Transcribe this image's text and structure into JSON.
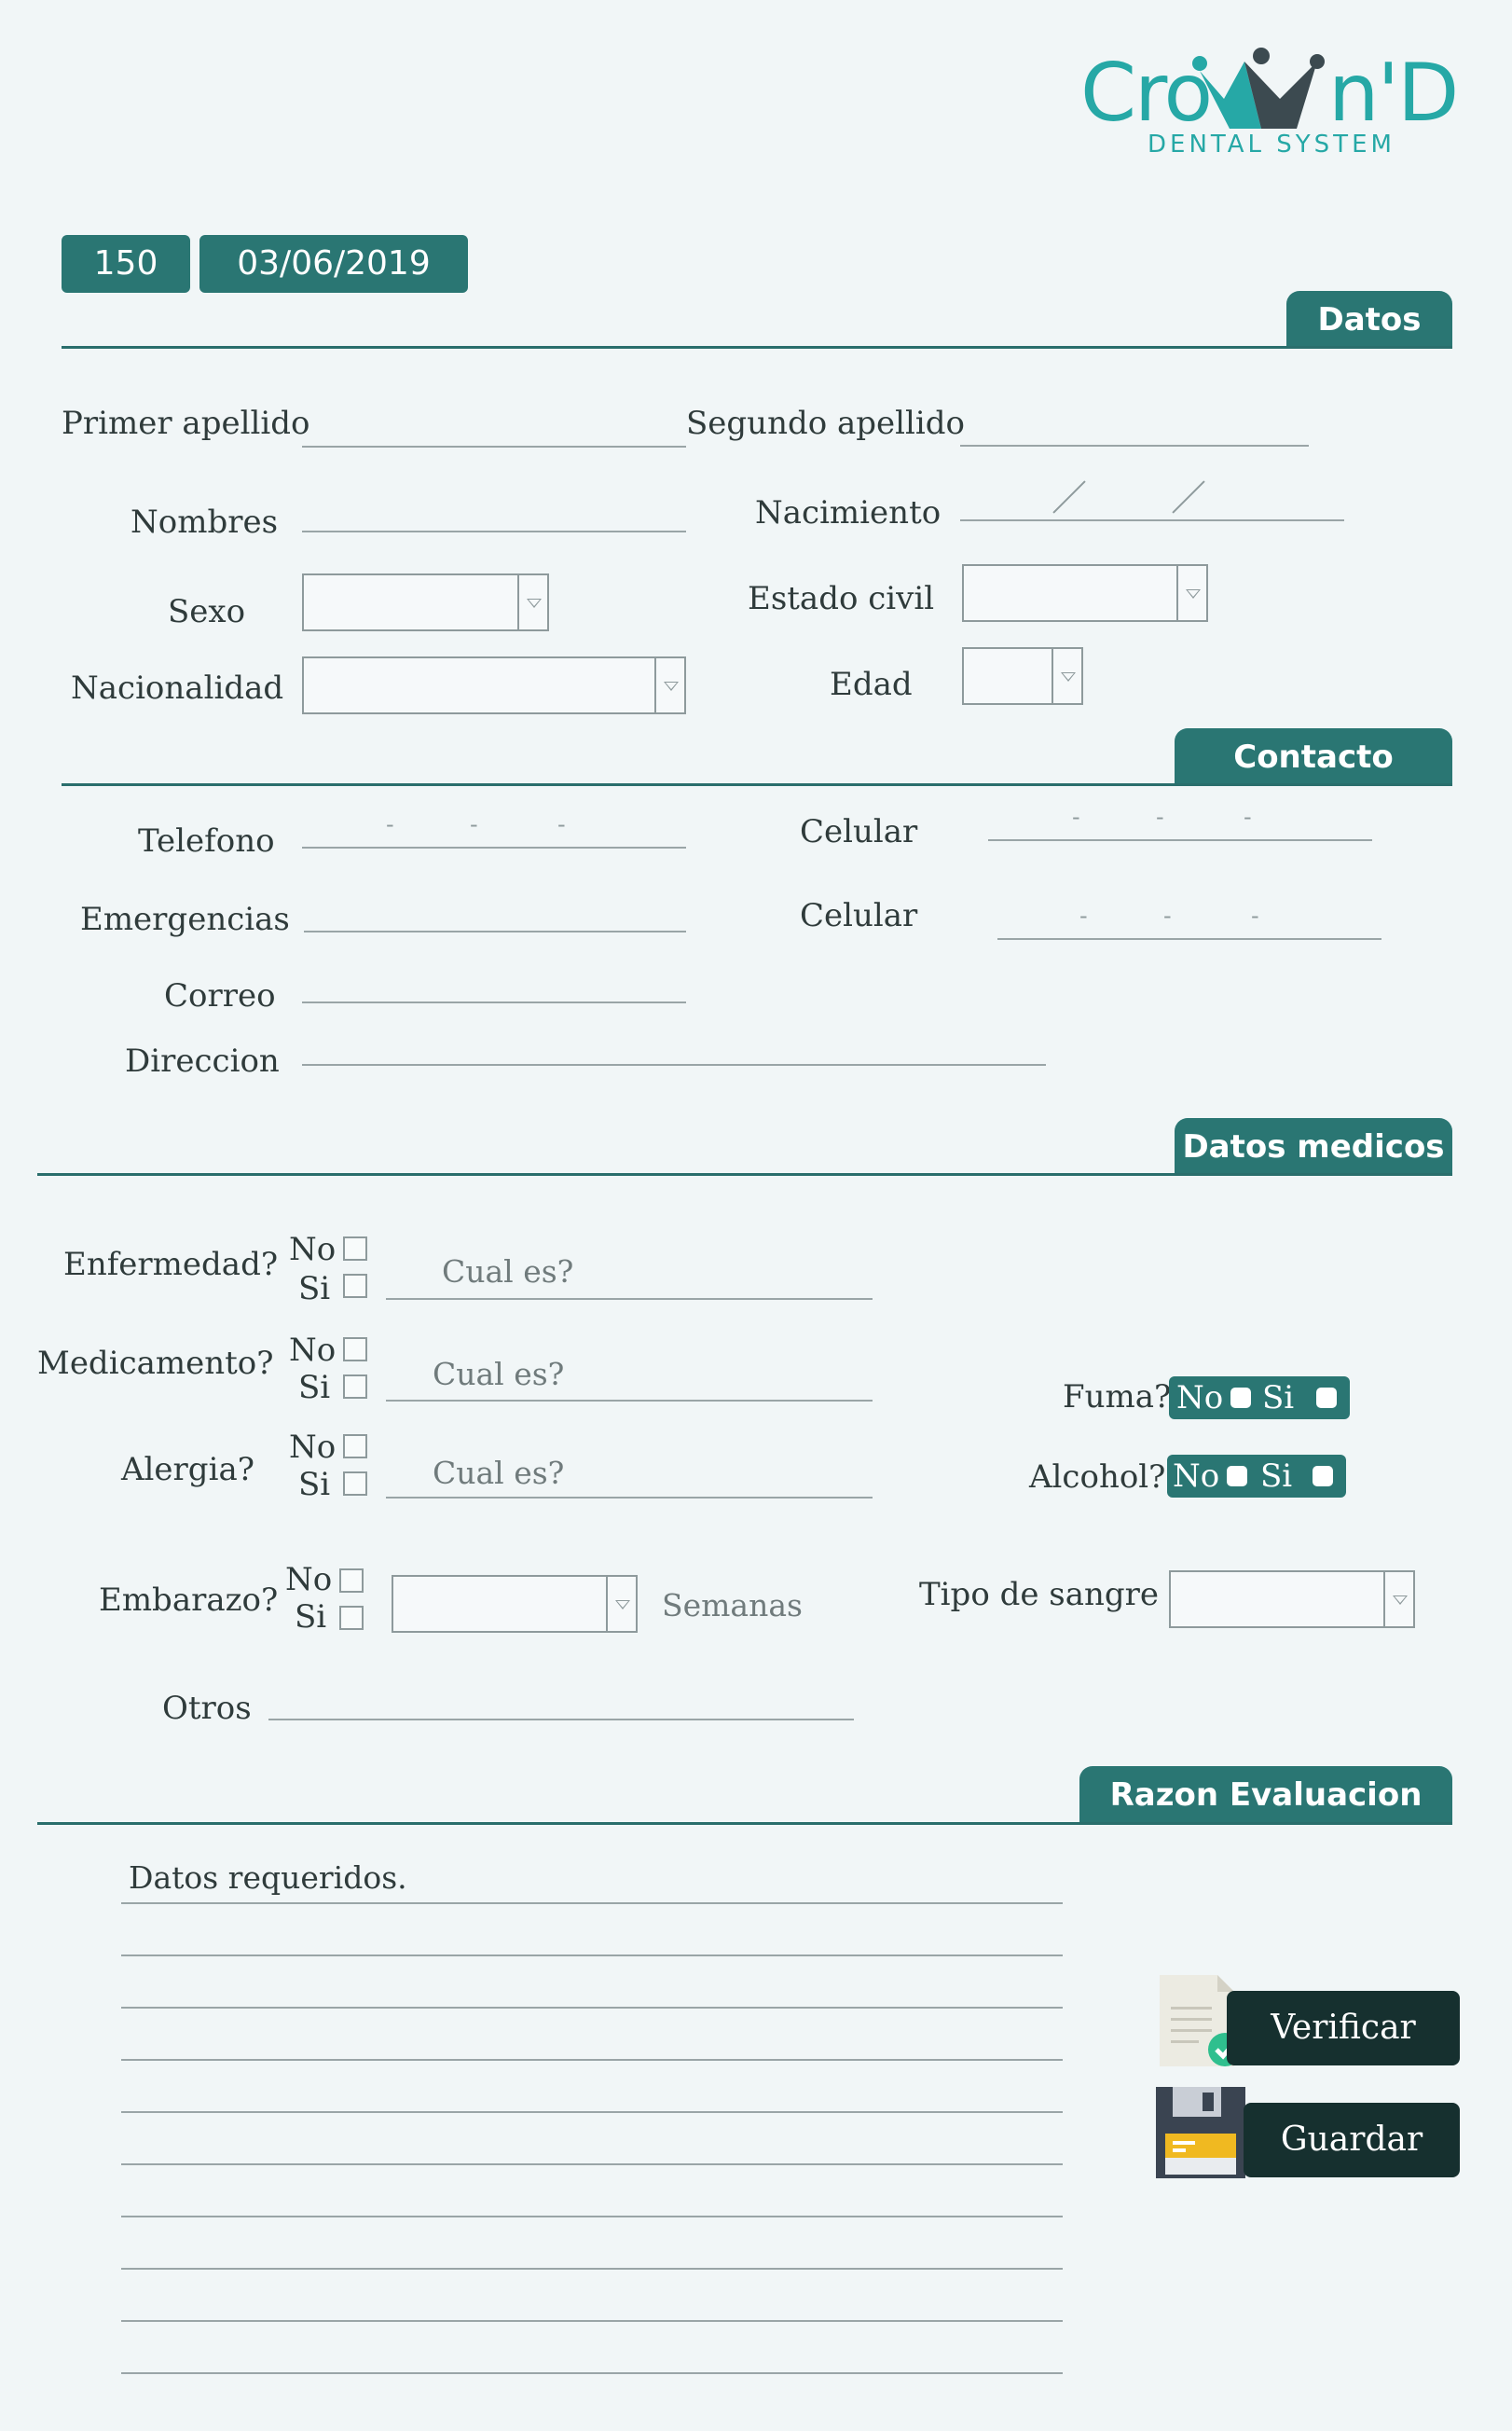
{
  "logo": {
    "name_part1": "Cro",
    "name_part2": "n'D",
    "tagline": "DENTAL SYSTEM"
  },
  "header": {
    "record_number": "150",
    "date": "03/06/2019"
  },
  "sections": {
    "datos": "Datos",
    "contacto": "Contacto",
    "datos_medicos": "Datos medicos",
    "razon": "Razon Evaluacion"
  },
  "datos": {
    "primer_apellido": "Primer apellido",
    "segundo_apellido": "Segundo apellido",
    "nombres": "Nombres",
    "nacimiento": "Nacimiento",
    "sexo": "Sexo",
    "estado_civil": "Estado civil",
    "nacionalidad": "Nacionalidad",
    "edad": "Edad"
  },
  "contacto": {
    "telefono": "Telefono",
    "celular1": "Celular",
    "emergencias": "Emergencias",
    "celular2": "Celular",
    "correo": "Correo",
    "direccion": "Direccion",
    "dash": "-"
  },
  "medicos": {
    "enfermedad": "Enfermedad?",
    "medicamento": "Medicamento?",
    "alergia": "Alergia?",
    "embarazo": "Embarazo?",
    "otros": "Otros",
    "no": "No",
    "si": "Si",
    "cual_es": "Cual es?",
    "semanas": "Semanas",
    "fuma": "Fuma?",
    "alcohol": "Alcohol?",
    "tipo_sangre": "Tipo de sangre"
  },
  "razon": {
    "first_line": "Datos requeridos."
  },
  "buttons": {
    "verificar": "Verificar",
    "guardar": "Guardar"
  },
  "colors": {
    "accent": "#2a7673",
    "dark": "#16302f",
    "background": "#f1f6f7",
    "logo_teal": "#26a8a6"
  }
}
